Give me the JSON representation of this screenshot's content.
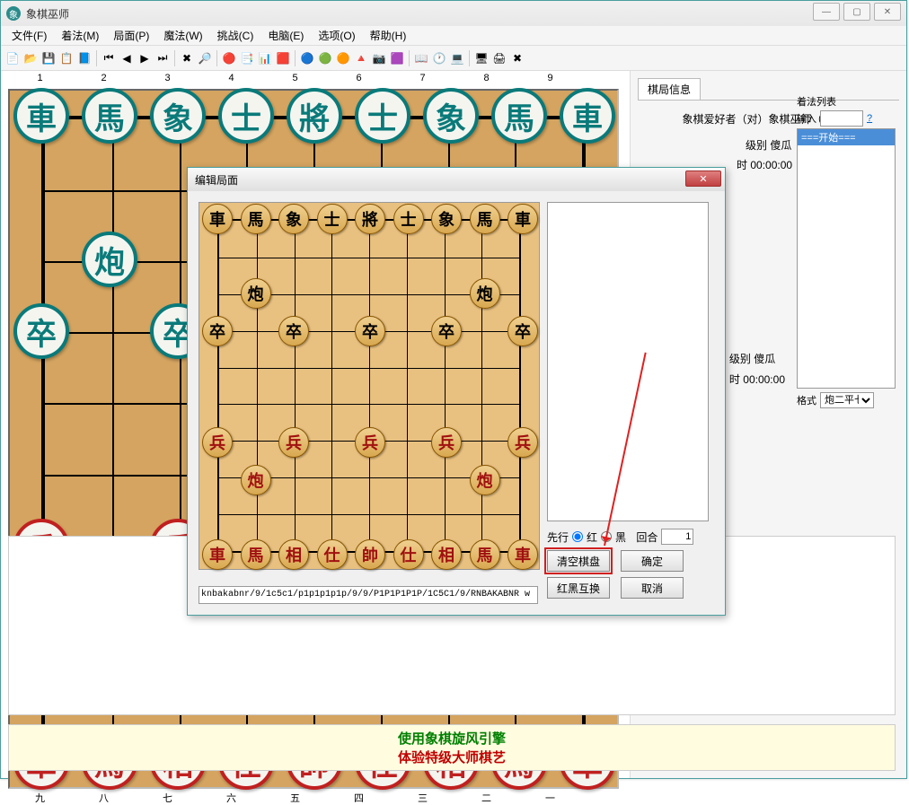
{
  "app": {
    "title": "象棋巫师",
    "icon_char": "象"
  },
  "menu": [
    "文件(F)",
    "着法(M)",
    "局面(P)",
    "魔法(W)",
    "挑战(C)",
    "电脑(E)",
    "选项(O)",
    "帮助(H)"
  ],
  "toolbar_icons": [
    "📄",
    "📂",
    "💾",
    "📋",
    "📘",
    "|",
    "⏮",
    "◀",
    "▶",
    "⏭",
    "|",
    "✖",
    "🔎",
    "|",
    "🔴",
    "📑",
    "📊",
    "🟥",
    "|",
    "🔵",
    "🟢",
    "🟠",
    "🔺",
    "📷",
    "🟪",
    "|",
    "📖",
    "🕐",
    "💻",
    "|",
    "🖥",
    "🖨",
    "✖"
  ],
  "board": {
    "top_nums": [
      "1",
      "2",
      "3",
      "4",
      "5",
      "6",
      "7",
      "8",
      "9"
    ],
    "bot_nums": [
      "九",
      "八",
      "七",
      "六",
      "五",
      "四",
      "三",
      "二",
      "一"
    ],
    "black_back": [
      "車",
      "馬",
      "象",
      "士",
      "將",
      "士",
      "象",
      "馬",
      "車"
    ],
    "red_back": [
      "車",
      "馬",
      "相",
      "仕",
      "帥",
      "仕",
      "相",
      "馬",
      "車"
    ],
    "cannon": "炮",
    "pawn_black": "卒",
    "pawn_red": "兵"
  },
  "side": {
    "tab_label": "棋局信息",
    "match_info": "象棋爱好者（对）象棋巫师（傻瓜）",
    "level_label": "级别",
    "level_value": "傻瓜",
    "time_label": "时",
    "time_value": "00:00:00",
    "movelist_header": "着法列表",
    "input_label": "输入",
    "help": "?",
    "start_marker": "===开始===",
    "format_label": "格式",
    "format_value": "炮二平七"
  },
  "ad": {
    "line1": "使用象棋旋风引擎",
    "line2": "体验特级大师棋艺"
  },
  "dialog": {
    "title": "编辑局面",
    "fen": "knbakabnr/9/1c5c1/p1p1p1p1p/9/9/P1P1P1P1P/1C5C1/9/RNBAKABNR w",
    "first_label": "先行",
    "radio_red": "红",
    "radio_black": "黑",
    "turn_label": "回合",
    "turn_value": "1",
    "btn_clear": "清空棋盘",
    "btn_ok": "确定",
    "btn_swap": "红黑互换",
    "btn_cancel": "取消",
    "mini_black_back": [
      "車",
      "馬",
      "象",
      "士",
      "將",
      "士",
      "象",
      "馬",
      "車"
    ],
    "mini_red_back": [
      "車",
      "馬",
      "相",
      "仕",
      "帥",
      "仕",
      "相",
      "馬",
      "車"
    ]
  }
}
